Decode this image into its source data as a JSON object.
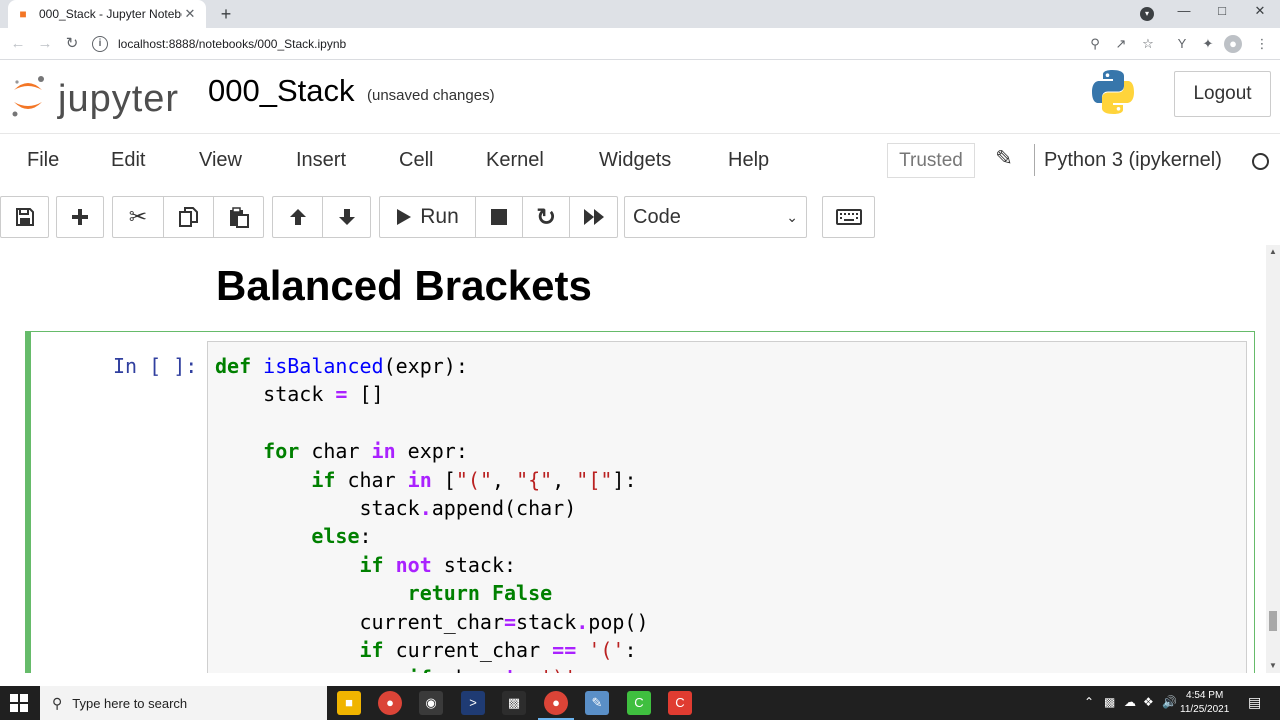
{
  "browser": {
    "tab_title": "000_Stack - Jupyter Notebook",
    "url": "localhost:8888/notebooks/000_Stack.ipynb"
  },
  "header": {
    "logo_text": "jupyter",
    "notebook_name": "000_Stack",
    "save_status": "(unsaved changes)",
    "logout_label": "Logout"
  },
  "menu": {
    "items": [
      "File",
      "Edit",
      "View",
      "Insert",
      "Cell",
      "Kernel",
      "Widgets",
      "Help"
    ],
    "trusted_label": "Trusted",
    "kernel_name": "Python 3 (ipykernel)"
  },
  "toolbar": {
    "run_label": "Run",
    "cell_type": "Code"
  },
  "notebook": {
    "heading": "Balanced Brackets",
    "cell_prompt": "In [ ]:"
  },
  "taskbar": {
    "search_placeholder": "Type here to search",
    "time": "4:54 PM",
    "date": "11/25/2021"
  },
  "colors": {
    "jupyter_orange": "#f37626",
    "cell_selected_border": "#66bb6a",
    "prompt_blue": "#303f9f",
    "keyword_green": "#008000",
    "function_blue": "#0000ff",
    "operator_purple": "#aa22ff",
    "string_red": "#ba2121"
  }
}
